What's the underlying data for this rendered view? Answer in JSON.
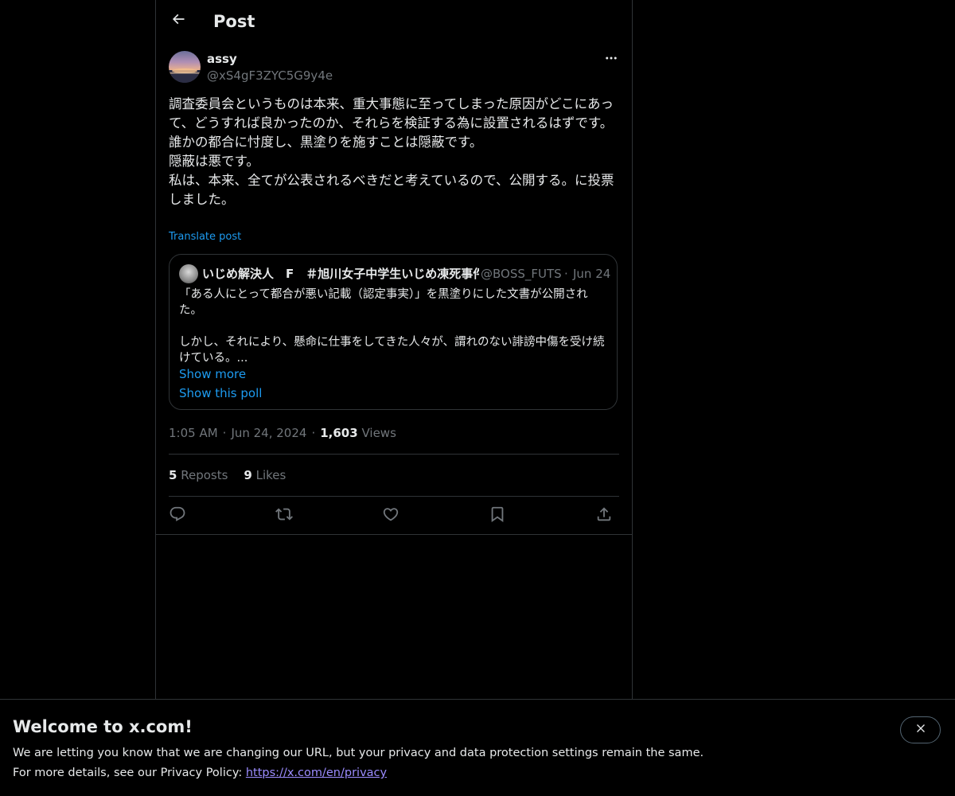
{
  "header": {
    "title": "Post",
    "back_icon": "arrow-left-icon"
  },
  "post": {
    "author_name": "assy",
    "author_handle": "@xS4gF3ZYC5G9y4e",
    "body": "調査委員会というものは本来、重大事態に至ってしまった原因がどこにあって、どうすれば良かったのか、それらを検証する為に設置されるはずです。\n誰かの都合に忖度し、黒塗りを施すことは隠蔽です。\n隠蔽は悪です。\n私は、本来、全てが公表されるべきだと考えているので、公開する。に投票しました。",
    "translate_label": "Translate post",
    "time": "1:05 AM",
    "date": "Jun 24, 2024",
    "views_count": "1,603",
    "views_label": "Views",
    "reposts_count": "5",
    "reposts_label": "Reposts",
    "likes_count": "9",
    "likes_label": "Likes"
  },
  "quote": {
    "author_name": "いじめ解決人　F　＃旭川女子中学生いじめ凍死事件",
    "author_handle": "@BOSS_FUTS",
    "separator": "·",
    "date": "Jun 24",
    "text": "「ある人にとって都合が悪い記載（認定事実）」を黒塗りにした文書が公開された。\n\nしかし、それにより、懸命に仕事をしてきた人々が、謂れのない誹謗中傷を受け続けている。...",
    "show_more": "Show more",
    "show_poll": "Show this poll"
  },
  "meta": {
    "separator": "·"
  },
  "actions": {
    "reply_icon": "reply-icon",
    "repost_icon": "repost-icon",
    "like_icon": "heart-icon",
    "bookmark_icon": "bookmark-icon",
    "share_icon": "share-icon"
  },
  "banner": {
    "title": "Welcome to x.com!",
    "line1": "We are letting you know that we are changing our URL, but your privacy and data protection settings remain the same.",
    "line2_prefix": "For more details, see our Privacy Policy: ",
    "link": "https://x.com/en/privacy",
    "close_icon": "close-icon"
  },
  "colors": {
    "background": "#000000",
    "text": "#e7e9ea",
    "muted": "#71767b",
    "accent": "#1d9bf0",
    "border": "#2f3336",
    "link_visited": "#9b8cff"
  }
}
